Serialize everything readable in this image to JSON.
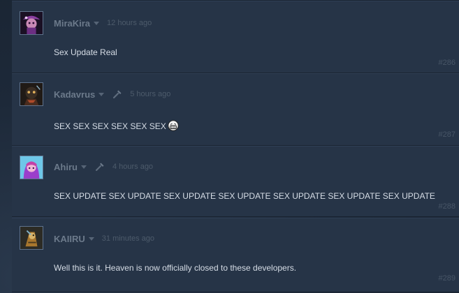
{
  "comments": [
    {
      "author": "MiraKira",
      "time": "12 hours ago",
      "text": "Sex Update Real",
      "number": "#286",
      "has_tool_icon": false,
      "avatar_icon": "purple-mushroom-girl-avatar"
    },
    {
      "author": "Kadavrus",
      "time": "5 hours ago",
      "text": "SEX SEX SEX SEX SEX SEX",
      "number": "#287",
      "has_tool_icon": true,
      "emoticon": "grinning-face-emoticon",
      "avatar_icon": "dark-skull-character-avatar"
    },
    {
      "author": "Ahiru",
      "time": "4 hours ago",
      "text": "SEX UPDATE SEX UPDATE SEX UPDATE SEX UPDATE SEX UPDATE SEX UPDATE SEX UPDATE",
      "number": "#288",
      "has_tool_icon": true,
      "avatar_icon": "pink-purple-anime-avatar"
    },
    {
      "author": "KAIIRU",
      "time": "31 minutes ago",
      "text": "Well this is it. Heaven is now officially closed to these developers.",
      "number": "#289",
      "has_tool_icon": false,
      "avatar_icon": "armored-bird-warrior-avatar"
    }
  ],
  "colors": {
    "panel": "#263447",
    "author": "#6c7a8b",
    "time": "#4d5b6b",
    "body_text": "#d6dde6",
    "number": "#485667"
  }
}
